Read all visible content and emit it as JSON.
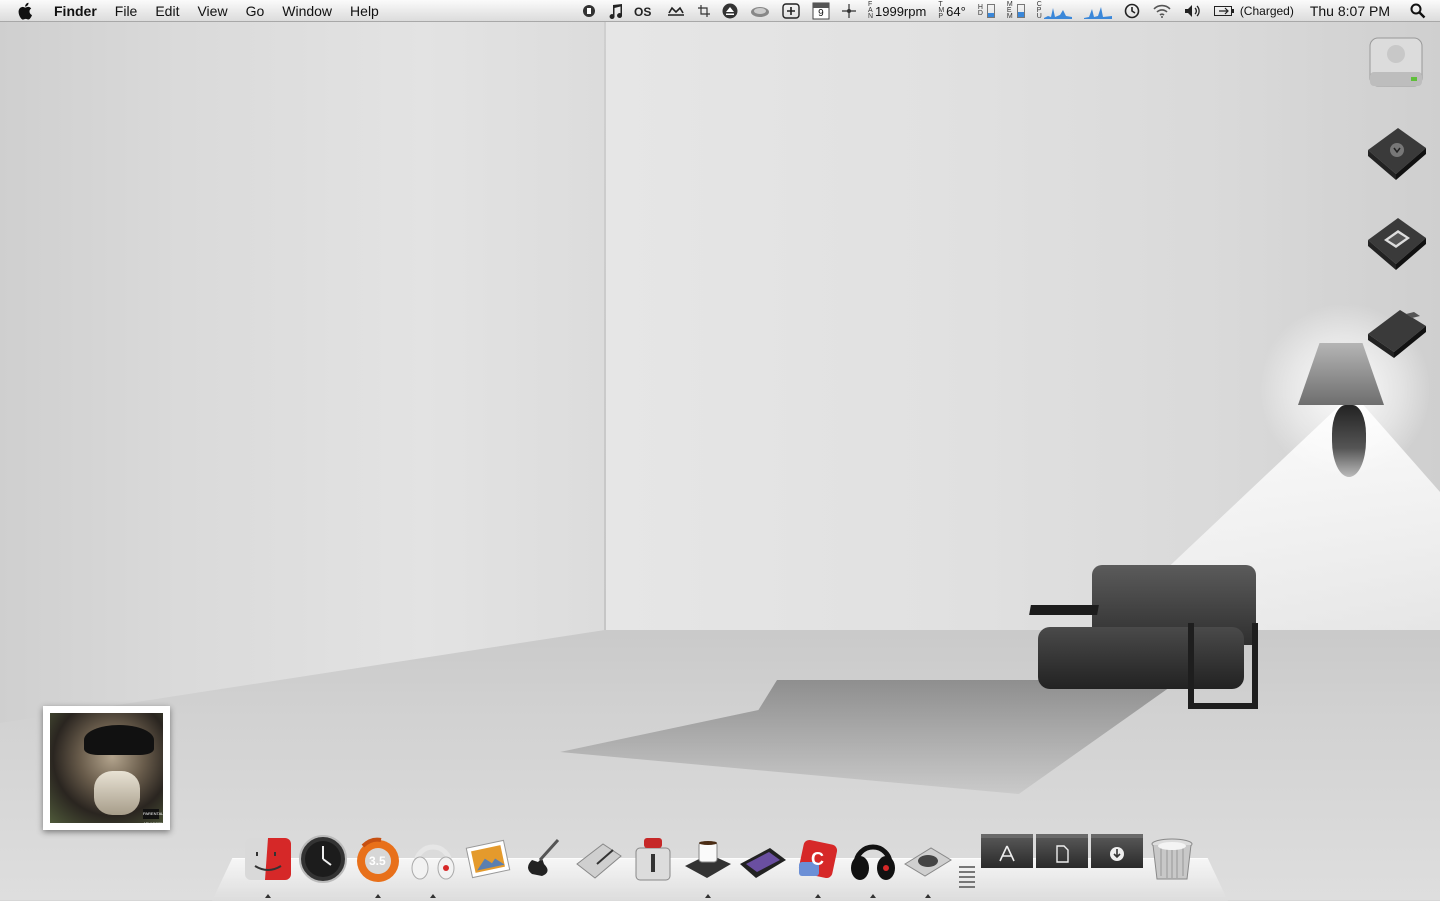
{
  "menubar": {
    "app_name": "Finder",
    "menus": [
      "File",
      "Edit",
      "View",
      "Go",
      "Window",
      "Help"
    ],
    "status": {
      "fan_label": [
        "F",
        "A",
        "N"
      ],
      "fan_speed": "1999rpm",
      "temp_label": [
        "T",
        "M",
        "P"
      ],
      "temperature": "64°",
      "hd_label": [
        "H",
        "D"
      ],
      "mem_label": [
        "M",
        "E",
        "M"
      ],
      "cpu_label": [
        "C",
        "P",
        "U"
      ],
      "calendar_day": "9",
      "battery_status": "(Charged)",
      "clock": "Thu 8:07 PM"
    }
  },
  "desktop": {
    "icons": [
      "hard-drive-icon",
      "downloads-drive-icon",
      "server-drive-icon",
      "folder-drive-icon"
    ],
    "album_advisory": "PARENTAL ADVISORY"
  },
  "dock": {
    "apps": [
      {
        "name": "finder",
        "running": true
      },
      {
        "name": "clock",
        "running": false
      },
      {
        "name": "firefox",
        "running": true
      },
      {
        "name": "beats-headphones",
        "running": true
      },
      {
        "name": "photos",
        "running": false
      },
      {
        "name": "guitar",
        "running": false
      },
      {
        "name": "notepad",
        "running": false
      },
      {
        "name": "transmission",
        "running": false
      },
      {
        "name": "coffee",
        "running": true
      },
      {
        "name": "photo-frame",
        "running": false
      },
      {
        "name": "red-app",
        "running": true
      },
      {
        "name": "beats-studio",
        "running": true
      },
      {
        "name": "speaker",
        "running": true
      }
    ],
    "firefox_badge": "3.5",
    "stacks": [
      "applications-stack",
      "documents-stack",
      "downloads-stack"
    ]
  },
  "colors": {
    "menubar_top": "#fbfbfb",
    "accent_blue": "#3a87d9",
    "finder_red": "#d62828"
  }
}
